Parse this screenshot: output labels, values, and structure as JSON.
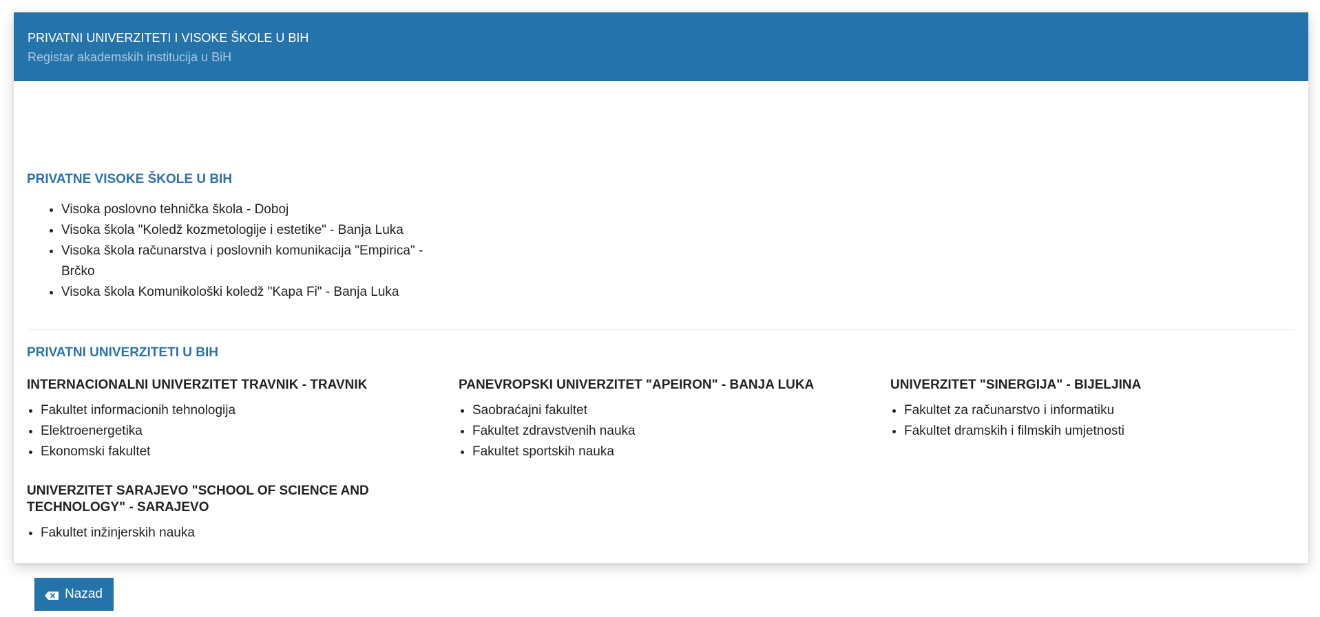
{
  "header": {
    "title": "PRIVATNI UNIVERZITETI I VISOKE ŠKOLE U BIH",
    "subtitle": "Registar akademskih institucija u BiH"
  },
  "schools_section": {
    "title": "PRIVATNE VISOKE ŠKOLE U BIH",
    "items": [
      "Visoka poslovno tehnička škola - Doboj",
      "Visoka škola \"Koledž kozmetologije i estetike\" - Banja Luka",
      "Visoka škola računarstva i poslovnih komunikacija \"Empirica\" - Brčko",
      "Visoka škola Komunikološki koledž \"Kapa Fi\" - Banja Luka"
    ]
  },
  "universities_section": {
    "title": "PRIVATNI UNIVERZITETI U BIH",
    "universities": [
      {
        "name": "INTERNACIONALNI UNIVERZITET TRAVNIK - TRAVNIK",
        "faculties": [
          "Fakultet informacionih tehnologija",
          "Elektroenergetika",
          "Ekonomski fakultet"
        ]
      },
      {
        "name": "PANEVROPSKI UNIVERZITET \"APEIRON\" - BANJA LUKA",
        "faculties": [
          "Saobraćajni fakultet",
          "Fakultet zdravstvenih nauka",
          "Fakultet sportskih nauka"
        ]
      },
      {
        "name": "UNIVERZITET \"SINERGIJA\" - BIJELJINA",
        "faculties": [
          "Fakultet za računarstvo i informatiku",
          "Fakultet dramskih i filmskih umjetnosti"
        ]
      },
      {
        "name": "UNIVERZITET SARAJEVO \"SCHOOL OF SCIENCE AND TECHNOLOGY\" - SARAJEVO",
        "faculties": [
          "Fakultet inžinjerskih nauka"
        ]
      }
    ]
  },
  "back_button": {
    "label": "Nazad",
    "icon": "backspace-icon"
  },
  "colors": {
    "header_bg": "#2573ab",
    "section_title": "#2a72ad",
    "button_bg": "#2573ab"
  }
}
